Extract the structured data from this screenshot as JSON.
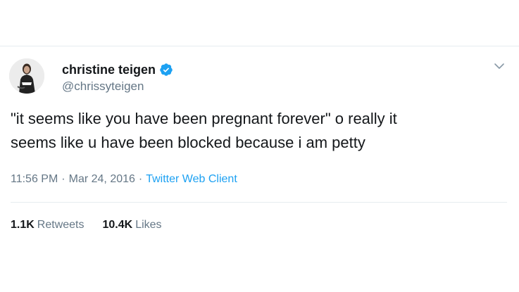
{
  "tweet": {
    "display_name": "christine teigen",
    "handle": "@chrissyteigen",
    "verified": true,
    "text_line1": "\"it seems like you have been pregnant forever\" o really it",
    "text_line2": "seems like u have been blocked because i am petty",
    "time": "11:56 PM",
    "date": "Mar 24, 2016",
    "client": "Twitter Web Client",
    "separator": "·",
    "retweets_count": "1.1K",
    "retweets_label": "Retweets",
    "likes_count": "10.4K",
    "likes_label": "Likes"
  },
  "icons": {
    "verified": "verified-badge-icon",
    "menu": "chevron-down-icon"
  },
  "colors": {
    "name": "#14171a",
    "muted": "#657786",
    "accent": "#1da1f2",
    "divider": "#e6ecf0"
  }
}
